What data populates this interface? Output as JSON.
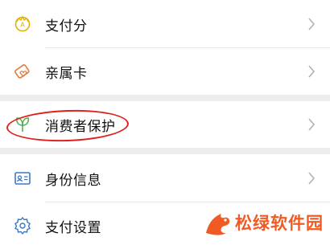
{
  "menu": {
    "group1": [
      {
        "label": "支付分",
        "icon": "score-icon"
      },
      {
        "label": "亲属卡",
        "icon": "family-card-icon"
      }
    ],
    "group2": [
      {
        "label": "消费者保护",
        "icon": "leaf-icon"
      }
    ],
    "group3": [
      {
        "label": "身份信息",
        "icon": "id-card-icon"
      },
      {
        "label": "支付设置",
        "icon": "gear-icon"
      }
    ]
  },
  "watermark": {
    "text": "松绿软件园"
  },
  "colors": {
    "icon_gold": "#e0b000",
    "icon_orange": "#e07a3a",
    "icon_green": "#4caf50",
    "icon_blue": "#3b78c5",
    "highlight_red": "#e0201b",
    "watermark_orange": "#f15a22"
  }
}
